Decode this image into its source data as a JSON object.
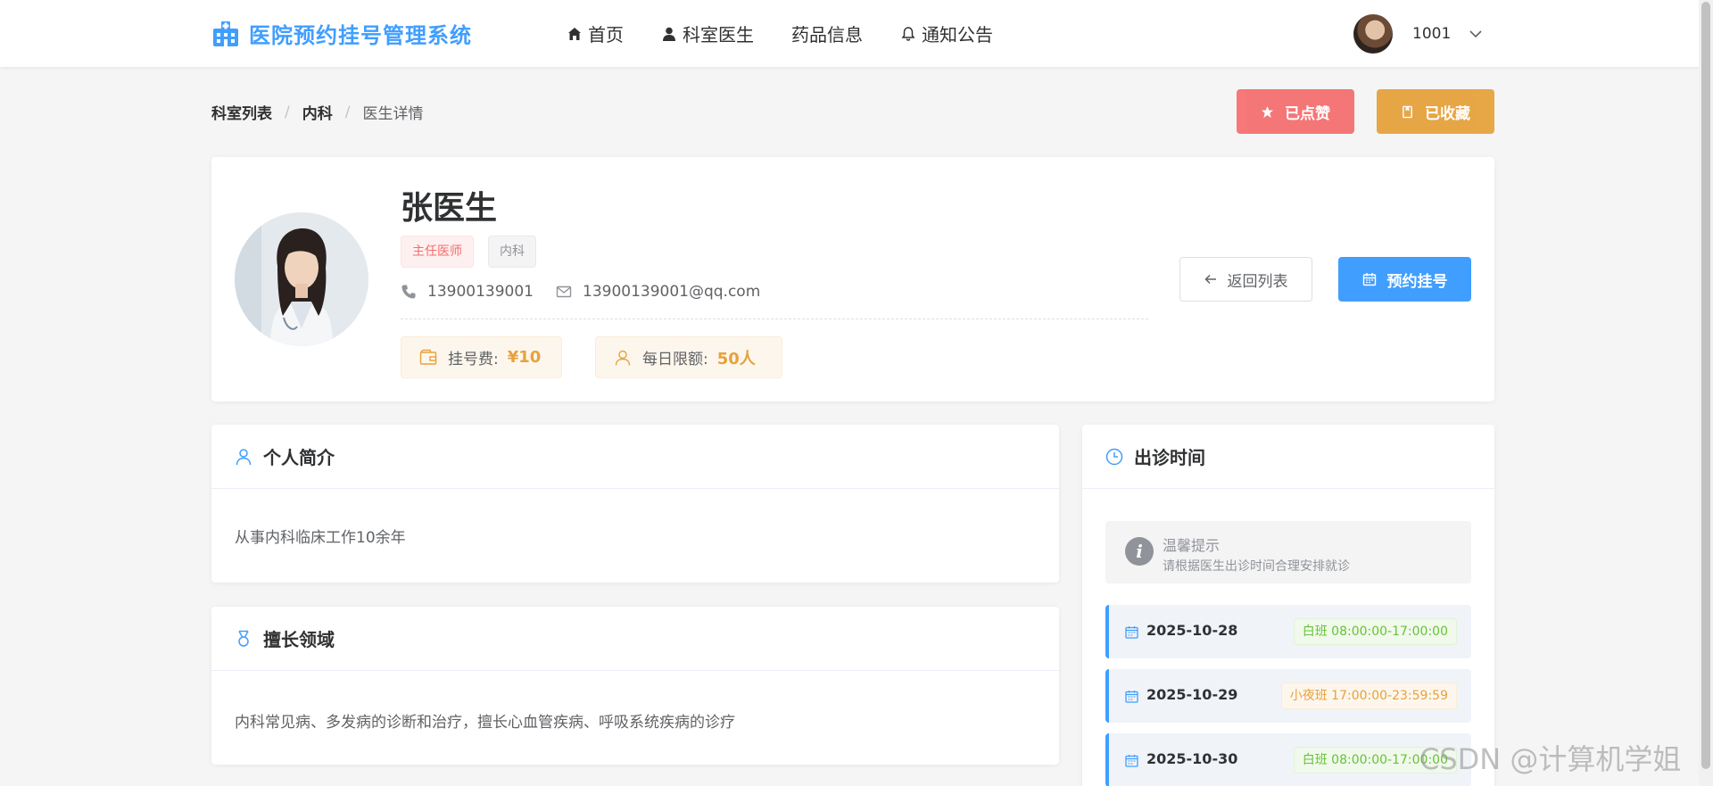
{
  "app": {
    "title": "医院预约挂号管理系统",
    "accent": "#409eff"
  },
  "nav": {
    "items": [
      {
        "label": "首页",
        "icon": "home-icon"
      },
      {
        "label": "科室医生",
        "icon": "user-icon"
      },
      {
        "label": "药品信息",
        "icon": ""
      },
      {
        "label": "通知公告",
        "icon": "bell-icon"
      }
    ]
  },
  "user": {
    "name": "1001"
  },
  "breadcrumb": {
    "items": [
      "科室列表",
      "内科",
      "医生详情"
    ],
    "separator": "/"
  },
  "actions": {
    "liked_label": "已点赞",
    "favorited_label": "已收藏",
    "back_label": "返回列表",
    "book_label": "预约挂号"
  },
  "doctor": {
    "name": "张医生",
    "title_tag": "主任医师",
    "dept_tag": "内科",
    "phone": "13900139001",
    "email": "13900139001@qq.com",
    "fee_label": "挂号费:",
    "fee_value": "¥10",
    "quota_label": "每日限额:",
    "quota_value": "50人"
  },
  "intro": {
    "title": "个人简介",
    "text": "从事内科临床工作10余年"
  },
  "skills": {
    "title": "擅长领域",
    "text": "内科常见病、多发病的诊断和治疗，擅长心血管疾病、呼吸系统疾病的诊疗"
  },
  "schedule": {
    "title": "出诊时间",
    "tip_title": "温馨提示",
    "tip_text": "请根据医生出诊时间合理安排就诊",
    "slots": [
      {
        "date": "2025-10-28",
        "shift": "白班 08:00:00-17:00:00",
        "type": "day"
      },
      {
        "date": "2025-10-29",
        "shift": "小夜班 17:00:00-23:59:59",
        "type": "night"
      },
      {
        "date": "2025-10-30",
        "shift": "白班 08:00:00-17:00:00",
        "type": "day"
      }
    ]
  },
  "watermark": "CSDN @计算机学姐",
  "colors": {
    "danger": "#f56c6c",
    "warning": "#e6a23c",
    "success": "#67c23a",
    "primary": "#409eff"
  }
}
